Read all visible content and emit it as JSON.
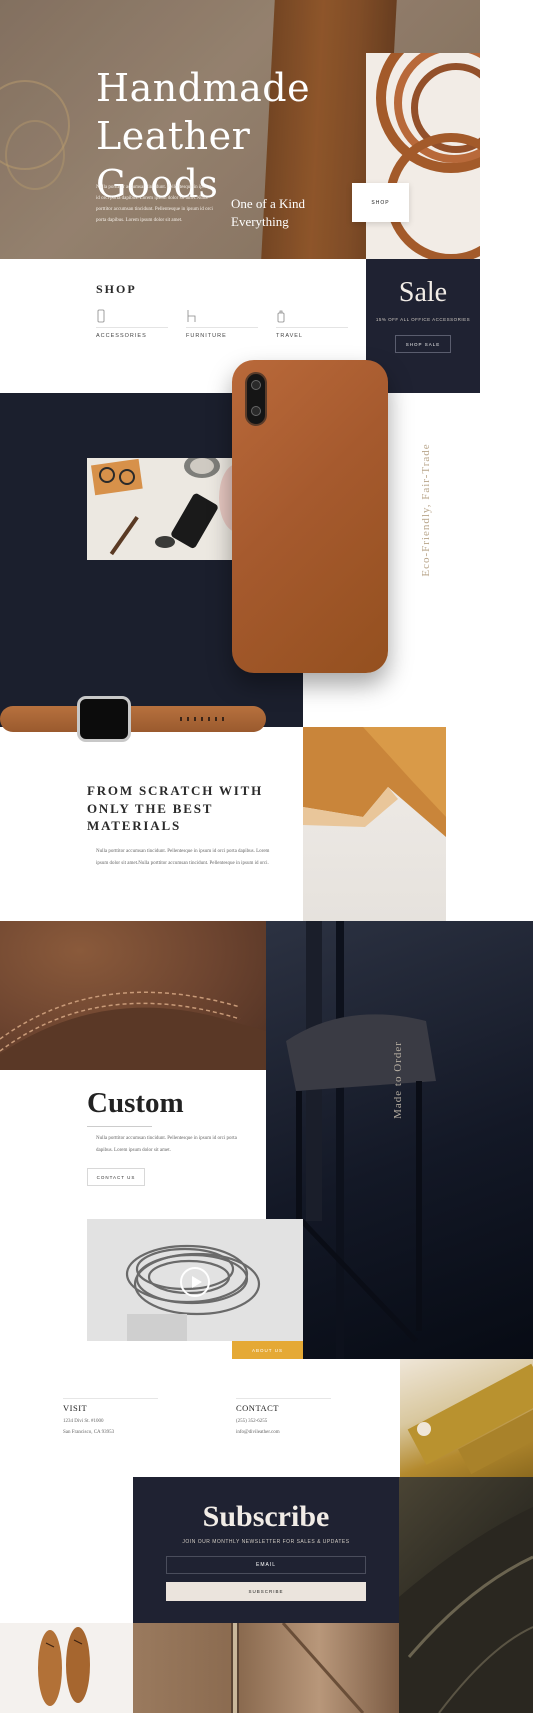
{
  "hero": {
    "title_line1": "Handmade",
    "title_line2": "Leather Goods",
    "body": "Nulla porttitor accumsan tincidunt. Pellentesque in ipsum id orci porta dapibus. Lorem ipsum dolor sit amet.Nulla porttitor accumsan tincidunt. Pellentesque in ipsum id orci porta dapibus. Lorem ipsum dolor sit amet.",
    "tagline_line1": "One of a Kind",
    "tagline_line2": "Everything",
    "shop_button": "SHOP"
  },
  "shop": {
    "title": "SHOP",
    "categories": [
      {
        "label": "ACCESSORIES",
        "icon": "phone-icon"
      },
      {
        "label": "FURNITURE",
        "icon": "chair-icon"
      },
      {
        "label": "TRAVEL",
        "icon": "luggage-icon"
      }
    ]
  },
  "sale": {
    "title": "Sale",
    "subtitle": "15% OFF ALL OFFICE ACCESSORIES",
    "button": "SHOP SALE"
  },
  "feature": {
    "vertical_text": "Eco-Friendly, Fair-Trade"
  },
  "scratch": {
    "title": "FROM SCRATCH WITH ONLY THE BEST MATERIALS",
    "body": "Nulla porttitor accumsan tincidunt. Pellentesque in ipsum id orci porta dapibus. Lorem ipsum dolor sit amet.Nulla porttitor accumsan tincidunt. Pellentesque in ipsum id orci."
  },
  "custom": {
    "title": "Custom",
    "body": "Nulla porttitor accumsan tincidunt. Pellentesque in ipsum id orci porta dapibus. Lorem ipsum dolor sit amet.",
    "contact_button": "CONTACT US",
    "vertical_text": "Made to Order",
    "about_button": "ABOUT US"
  },
  "visit": {
    "title": "VISIT",
    "line1": "1234 Divi St. #1000",
    "line2": "San Francisco, CA 93953"
  },
  "contact": {
    "title": "CONTACT",
    "line1": "(255) 352-6255",
    "line2": "info@divileather.com"
  },
  "subscribe": {
    "title": "Subscribe",
    "subtitle": "JOIN OUR MONTHLY NEWSLETTER FOR SALES & UPDATES",
    "email_placeholder": "EMAIL",
    "button": "SUBSCRIBE"
  },
  "colors": {
    "navy": "#1f2232",
    "accent_gold": "#e5a935",
    "sale_bg": "#1f2232",
    "leather": "#a65a2e"
  }
}
